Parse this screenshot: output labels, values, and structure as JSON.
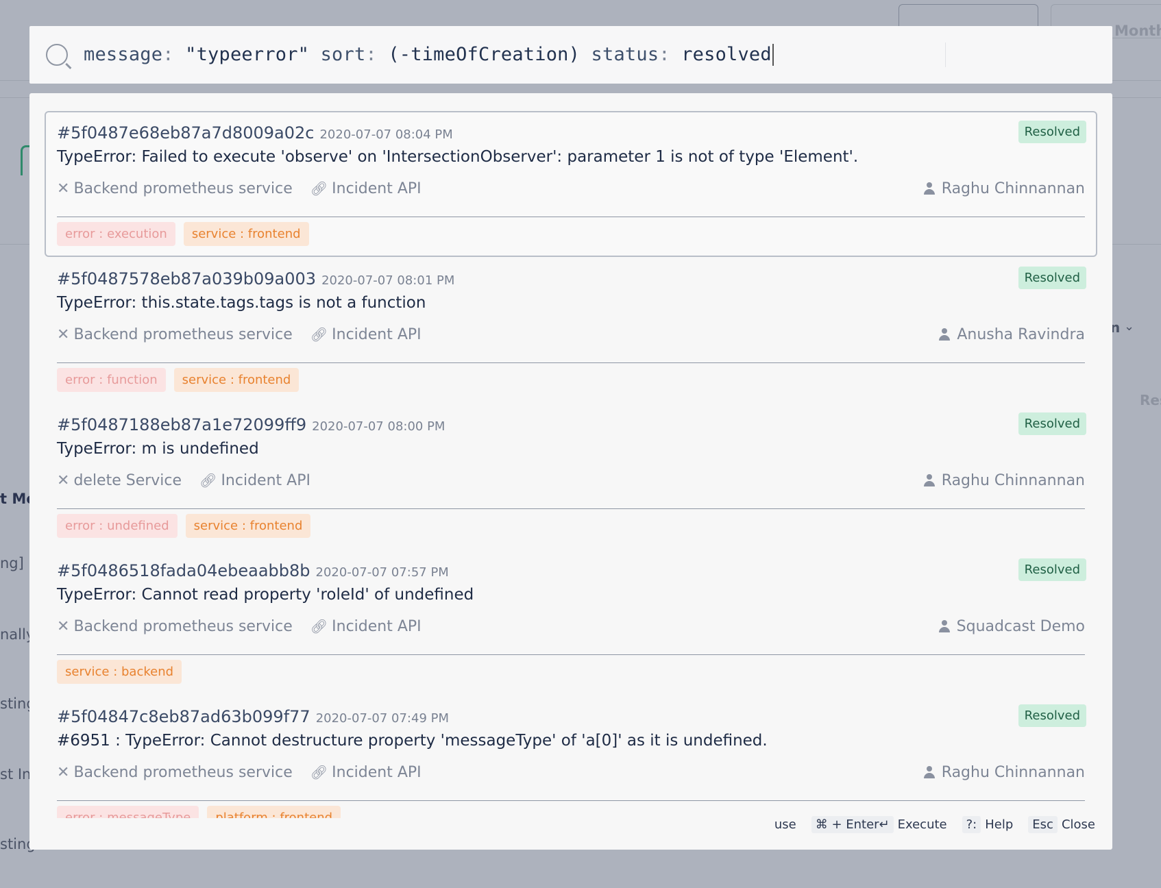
{
  "background": {
    "month_label": "Month",
    "left_fragments": [
      "t Mes",
      "ng] [(",
      "nally",
      "sting",
      "st In",
      "sting"
    ],
    "right_fragment_n": "n",
    "right_fragment_res": "Res"
  },
  "search": {
    "query_tokens": [
      {
        "type": "key",
        "text": "message"
      },
      {
        "type": "punct",
        "text": ": "
      },
      {
        "type": "value",
        "text": "\"typeerror\" "
      },
      {
        "type": "key",
        "text": "sort"
      },
      {
        "type": "punct",
        "text": ": "
      },
      {
        "type": "value",
        "text": "(-timeOfCreation) "
      },
      {
        "type": "key",
        "text": "status"
      },
      {
        "type": "punct",
        "text": ": "
      },
      {
        "type": "value",
        "text": "resolved"
      }
    ]
  },
  "results": [
    {
      "id": "#5f0487e68eb87a7d8009a02c",
      "date": "2020-07-07 08:04 PM",
      "status": "Resolved",
      "message": "TypeError: Failed to execute 'observe' on 'IntersectionObserver': parameter 1 is not of type 'Element'.",
      "service": "Backend prometheus service",
      "integration": "Incident API",
      "assignee": "Raghu Chinnannan",
      "tags": [
        {
          "kind": "err",
          "text": "error : execution"
        },
        {
          "kind": "svc",
          "text": "service : frontend"
        }
      ],
      "selected": true
    },
    {
      "id": "#5f0487578eb87a039b09a003",
      "date": "2020-07-07 08:01 PM",
      "status": "Resolved",
      "message": "TypeError: this.state.tags.tags is not a function",
      "service": "Backend prometheus service",
      "integration": "Incident API",
      "assignee": "Anusha Ravindra",
      "tags": [
        {
          "kind": "err",
          "text": "error : function"
        },
        {
          "kind": "svc",
          "text": "service : frontend"
        }
      ],
      "selected": false
    },
    {
      "id": "#5f0487188eb87a1e72099ff9",
      "date": "2020-07-07 08:00 PM",
      "status": "Resolved",
      "message": "TypeError: m is undefined",
      "service": "delete Service",
      "integration": "Incident API",
      "assignee": "Raghu Chinnannan",
      "tags": [
        {
          "kind": "err",
          "text": "error : undefined"
        },
        {
          "kind": "svc",
          "text": "service : frontend"
        }
      ],
      "selected": false
    },
    {
      "id": "#5f0486518fada04ebeaabb8b",
      "date": "2020-07-07 07:57 PM",
      "status": "Resolved",
      "message": "TypeError: Cannot read property 'roleId' of undefined",
      "service": "Backend prometheus service",
      "integration": "Incident API",
      "assignee": "Squadcast Demo",
      "tags": [
        {
          "kind": "svc",
          "text": "service : backend"
        }
      ],
      "selected": false
    },
    {
      "id": "#5f04847c8eb87ad63b099f77",
      "date": "2020-07-07 07:49 PM",
      "status": "Resolved",
      "message": "#6951 : TypeError: Cannot destructure property 'messageType' of 'a[0]' as it is undefined.",
      "service": "Backend prometheus service",
      "integration": "Incident API",
      "assignee": "Raghu Chinnannan",
      "tags": [
        {
          "kind": "err",
          "text": "error : messageType"
        },
        {
          "kind": "svc",
          "text": "platform : frontend"
        }
      ],
      "selected": false
    }
  ],
  "footer": {
    "use_label": "use",
    "execute_key": "⌘ + Enter↵",
    "execute_label": "Execute",
    "help_key": "?:",
    "help_label": "Help",
    "close_key": "Esc",
    "close_label": "Close"
  },
  "colors": {
    "resolved_badge_bg": "#cdeedd",
    "resolved_badge_text": "#1f5f44",
    "error_tag_bg": "#fbe3e3",
    "error_tag_text": "#e79a9a",
    "service_tag_bg": "#fbe6d6",
    "service_tag_text": "#e8822f"
  }
}
